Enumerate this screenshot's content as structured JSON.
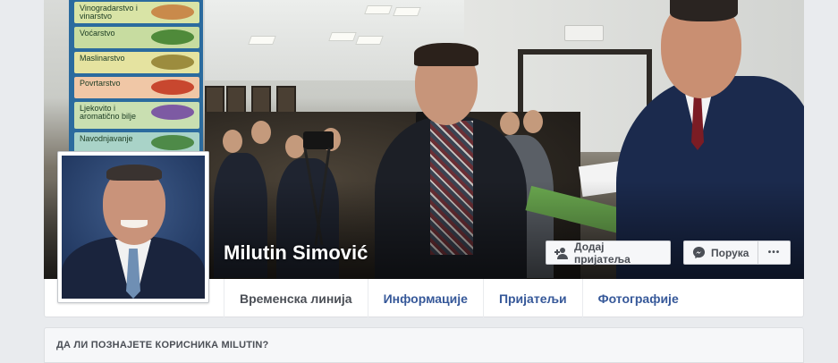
{
  "profile": {
    "name": "Milutin Simović"
  },
  "actions": {
    "add_friend_label": "Додај пријатеља",
    "message_label": "Порука",
    "more_label": "•••"
  },
  "tabs": [
    {
      "label": "Временска линија",
      "active": true
    },
    {
      "label": "Информације",
      "active": false
    },
    {
      "label": "Пријатељи",
      "active": false
    },
    {
      "label": "Фотографије",
      "active": false
    }
  ],
  "poster": {
    "items": [
      {
        "label": "Vinogradarstvo i vinarstvo",
        "color": "#d9e4a6"
      },
      {
        "label": "Voćarstvo",
        "color": "#c7dca0"
      },
      {
        "label": "Maslinarstvo",
        "color": "#e5e3a0"
      },
      {
        "label": "Povrtarstvo",
        "color": "#f0c7a6"
      },
      {
        "label": "Ljekovito i aromatično bilje",
        "color": "#c9dfb1"
      },
      {
        "label": "Navodnjavanje",
        "color": "#a9d3c8"
      }
    ]
  },
  "know_section": {
    "title": "ДА ЛИ ПОЗНАЈЕТЕ КОРИСНИКА MILUTIN?"
  },
  "colors": {
    "link": "#365899",
    "page_bg": "#e9ebee",
    "button_bg": "#f6f7f9"
  }
}
